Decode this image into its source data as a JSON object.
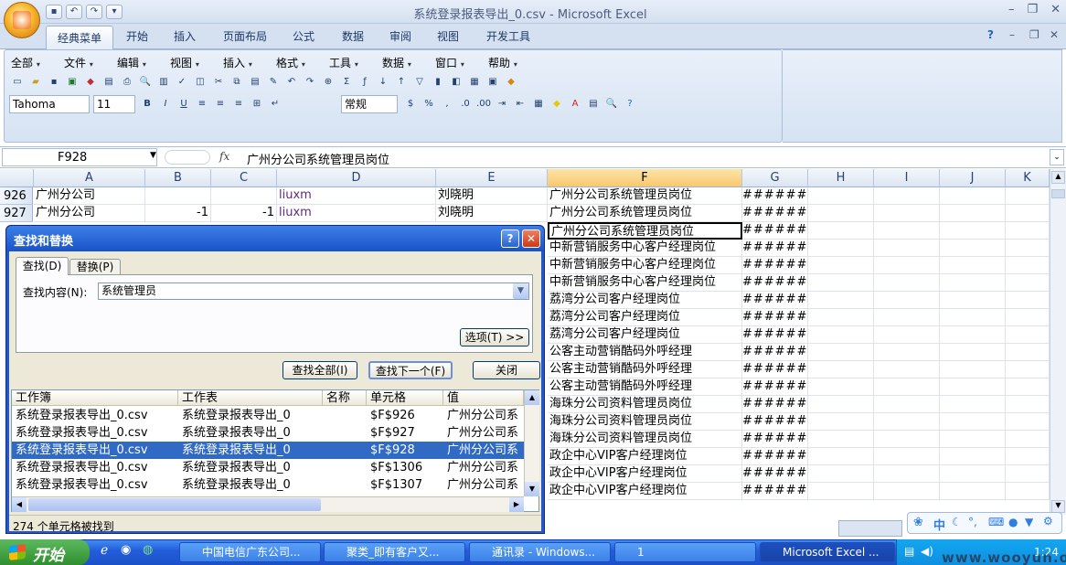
{
  "window": {
    "title": "系统登录报表导出_0.csv - Microsoft Excel",
    "minimize": "–",
    "restore": "❐",
    "close": "✕"
  },
  "ribbon_tabs": [
    "经典菜单",
    "开始",
    "插入",
    "页面布局",
    "公式",
    "数据",
    "审阅",
    "视图",
    "开发工具"
  ],
  "classic_menu": [
    "全部",
    "文件",
    "编辑",
    "视图",
    "插入",
    "格式",
    "工具",
    "数据",
    "窗口",
    "帮助"
  ],
  "font": {
    "name": "Tahoma",
    "size": "11",
    "number_format": "常规"
  },
  "formula_bar": {
    "name_box": "F928",
    "fx": "fx",
    "value": "广州分公司系统管理员岗位"
  },
  "columns": [
    "A",
    "B",
    "C",
    "D",
    "E",
    "F",
    "G",
    "H",
    "I",
    "J",
    "K"
  ],
  "rows": [
    {
      "num": "926",
      "a": "广州分公司",
      "b": "",
      "c": "",
      "d": "liuxm",
      "e": "刘晓明"
    },
    {
      "num": "927",
      "a": "广州分公司",
      "b": "-1",
      "c": "-1",
      "d": "liuxm",
      "e": "刘晓明"
    }
  ],
  "f_column": [
    "广州分公司系统管理员岗位",
    "广州分公司系统管理员岗位",
    "广州分公司系统管理员岗位",
    "中新营销服务中心客户经理岗位",
    "中新营销服务中心客户经理岗位",
    "中新营销服务中心客户经理岗位",
    "荔湾分公司客户经理岗位",
    "荔湾分公司客户经理岗位",
    "荔湾分公司客户经理岗位",
    "公客主动营销酷码外呼经理",
    "公客主动营销酷码外呼经理",
    "公客主动营销酷码外呼经理",
    "海珠分公司资料管理员岗位",
    "海珠分公司资料管理员岗位",
    "海珠分公司资料管理员岗位",
    "政企中心VIP客户经理岗位",
    "政企中心VIP客户经理岗位",
    "政企中心VIP客户经理岗位"
  ],
  "g_value": "######",
  "dialog": {
    "title": "查找和替换",
    "help": "?",
    "close": "✕",
    "tab_find": "查找(D)",
    "tab_replace": "替换(P)",
    "find_label": "查找内容(N):",
    "find_value": "系统管理员",
    "options_btn": "选项(T) >>",
    "find_all_btn": "查找全部(I)",
    "find_next_btn": "查找下一个(F)",
    "close_btn": "关闭",
    "result_headers": [
      "工作簿",
      "工作表",
      "名称",
      "单元格",
      "值"
    ],
    "results": [
      {
        "book": "系统登录报表导出_0.csv",
        "sheet": "系统登录报表导出_0",
        "cell": "$F$926",
        "value": "广州分公司系"
      },
      {
        "book": "系统登录报表导出_0.csv",
        "sheet": "系统登录报表导出_0",
        "cell": "$F$927",
        "value": "广州分公司系"
      },
      {
        "book": "系统登录报表导出_0.csv",
        "sheet": "系统登录报表导出_0",
        "cell": "$F$928",
        "value": "广州分公司系"
      },
      {
        "book": "系统登录报表导出_0.csv",
        "sheet": "系统登录报表导出_0",
        "cell": "$F$1306",
        "value": "广州分公司系"
      },
      {
        "book": "系统登录报表导出_0.csv",
        "sheet": "系统登录报表导出_0",
        "cell": "$F$1307",
        "value": "广州分公司系"
      }
    ],
    "selected_index": 2,
    "status": "274 个单元格被找到"
  },
  "taskbar": {
    "start": "开始",
    "tasks": [
      "中国电信广东公司...",
      "聚类_即有客户又...",
      "通讯录 - Windows...",
      "1",
      "Microsoft Excel ..."
    ],
    "clock": "1:24"
  },
  "ime": {
    "label": "中"
  },
  "watermark": "www.wooyun.org"
}
